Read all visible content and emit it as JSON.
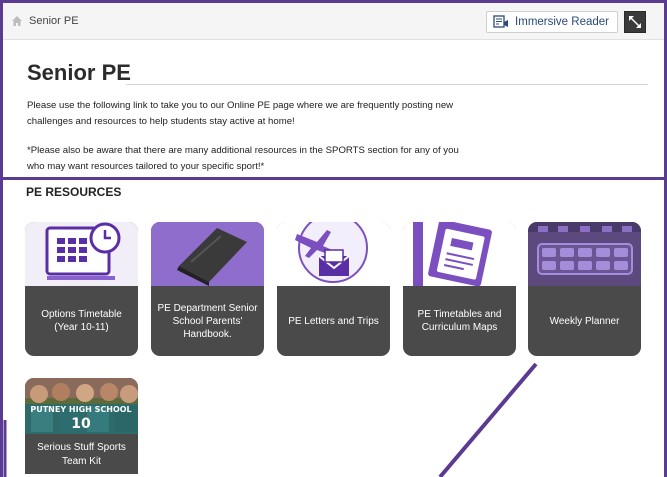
{
  "breadcrumb": {
    "label": "Senior PE"
  },
  "toolbar": {
    "immersive_reader": "Immersive Reader"
  },
  "page": {
    "title": "Senior PE",
    "paragraph1": "Please use the following link to take you to our Online PE page where we are frequently posting new challenges and resources to help students stay active at home!",
    "paragraph2": "*Please also be aware that there are many additional resources in the SPORTS section for any of you who may want resources tailored to your specific sport!*"
  },
  "resources": {
    "title": "PE RESOURCES",
    "tiles": [
      {
        "label": "Options Timetable (Year 10-11)",
        "icon": "calendar-clock-icon"
      },
      {
        "label": "PE Department Senior School Parents' Handbook.",
        "icon": "book-icon"
      },
      {
        "label": "PE Letters and Trips",
        "icon": "plane-letter-icon"
      },
      {
        "label": "PE Timetables and Curriculum Maps",
        "icon": "notebook-icon"
      },
      {
        "label": "Weekly Planner",
        "icon": "planner-icon"
      },
      {
        "label": "Serious Stuff Sports Team Kit",
        "icon": "team-photo",
        "photo_text": "PUTNEY HIGH SCHOOL",
        "photo_number": "10"
      }
    ]
  },
  "colors": {
    "accent": "#5b3a91",
    "tile_bg": "#4a4a4a",
    "icon_purple": "#7b4fc0"
  }
}
